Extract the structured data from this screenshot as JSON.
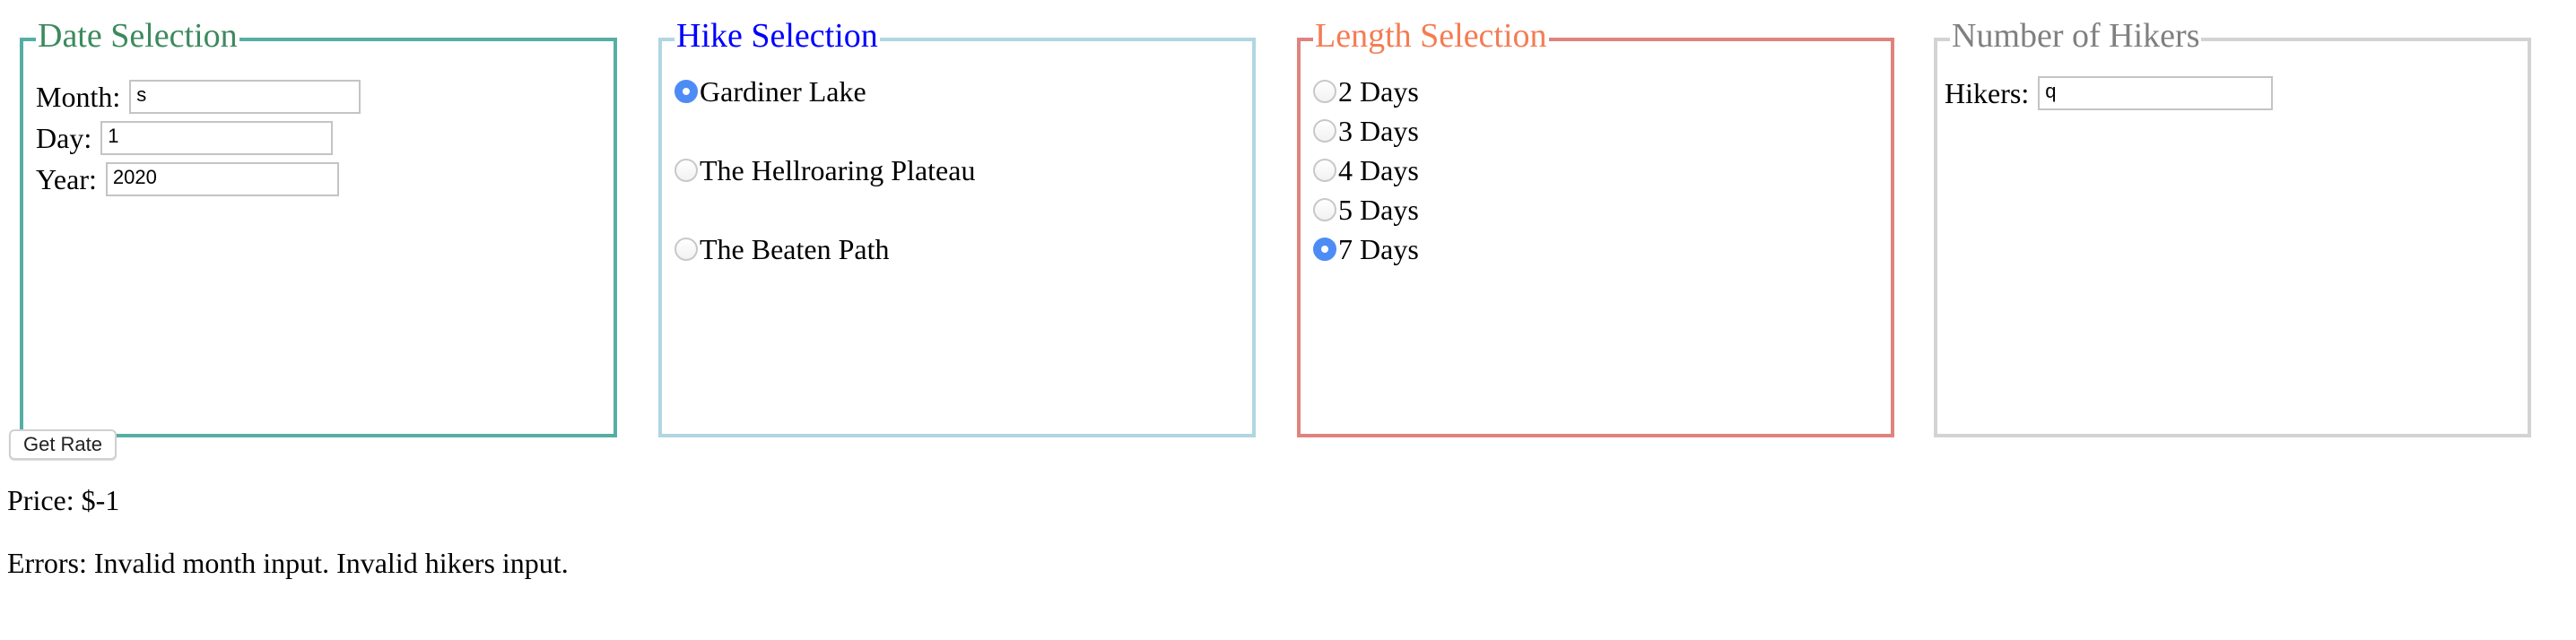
{
  "date": {
    "legend": "Date Selection",
    "month_label": "Month:",
    "month_value": "s",
    "day_label": "Day:",
    "day_value": "1",
    "year_label": "Year:",
    "year_value": "2020"
  },
  "hike": {
    "legend": "Hike Selection",
    "options": [
      {
        "label": "Gardiner Lake",
        "selected": true
      },
      {
        "label": "The Hellroaring Plateau",
        "selected": false
      },
      {
        "label": "The Beaten Path",
        "selected": false
      }
    ]
  },
  "length": {
    "legend": "Length Selection",
    "options": [
      {
        "label": "2 Days",
        "selected": false
      },
      {
        "label": "3 Days",
        "selected": false
      },
      {
        "label": "4 Days",
        "selected": false
      },
      {
        "label": "5 Days",
        "selected": false
      },
      {
        "label": "7 Days",
        "selected": true
      }
    ]
  },
  "hikers": {
    "legend": "Number of Hikers",
    "label": "Hikers:",
    "value": "q"
  },
  "actions": {
    "get_rate_label": "Get Rate"
  },
  "result": {
    "price": "Price: $-1",
    "errors": "Errors: Invalid month input. Invalid hikers input."
  }
}
